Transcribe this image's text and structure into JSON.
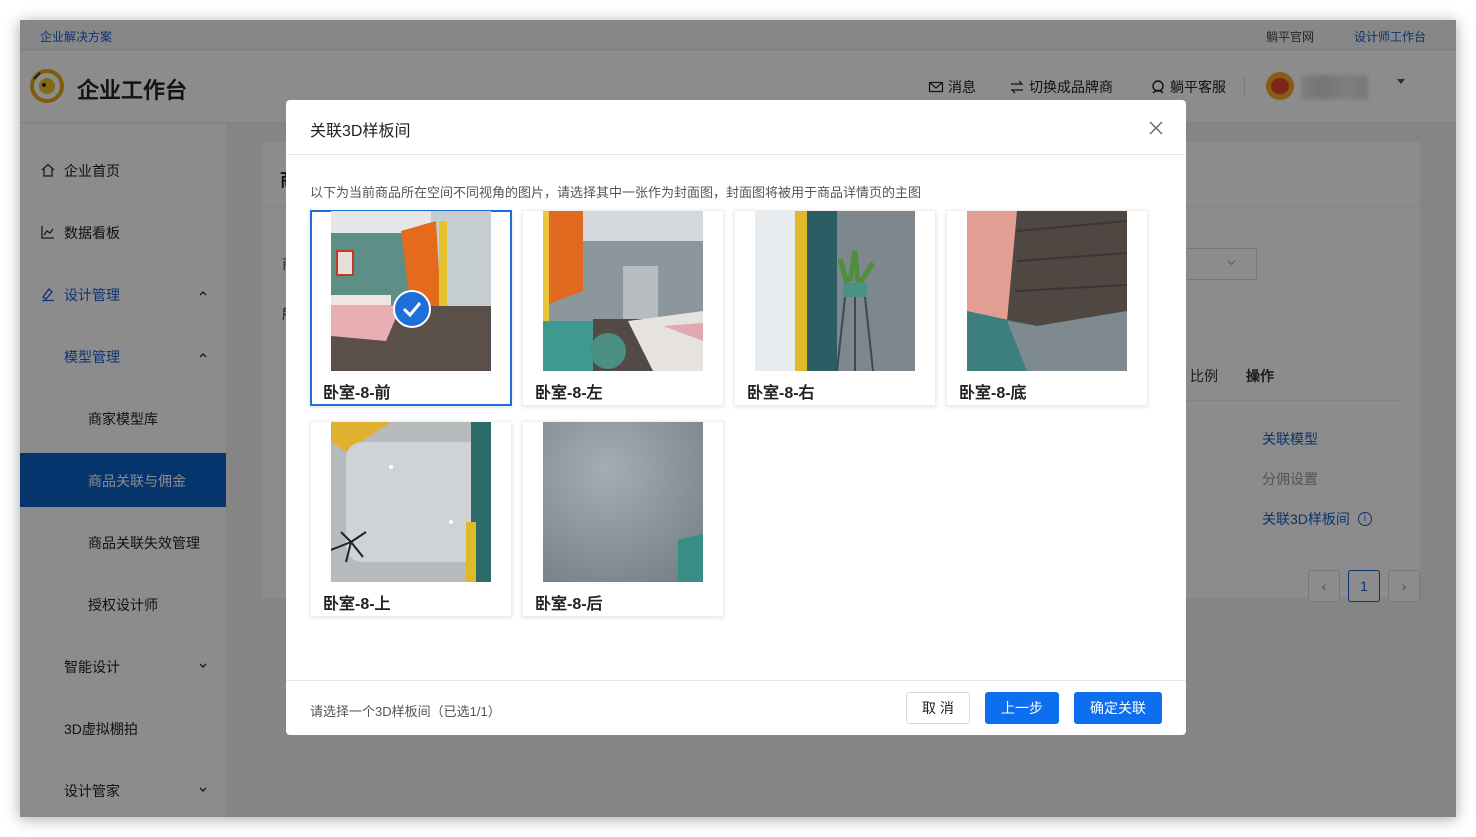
{
  "topbar": {
    "left_link": "企业解决方案",
    "right_link_1": "躺平官网",
    "right_link_2": "设计师工作台"
  },
  "header": {
    "app_title": "企业工作台",
    "nav": [
      {
        "icon": "mail-icon",
        "label": "消息"
      },
      {
        "icon": "switch-icon",
        "label": "切换成品牌商"
      },
      {
        "icon": "headset-icon",
        "label": "躺平客服"
      }
    ]
  },
  "sidebar": {
    "items": [
      {
        "label": "企业首页",
        "icon": "home-icon"
      },
      {
        "label": "数据看板",
        "icon": "chart-icon"
      },
      {
        "label": "设计管理",
        "icon": "design-icon",
        "expanded": true
      },
      {
        "label": "模型管理",
        "expanded": true
      },
      {
        "label": "商家模型库"
      },
      {
        "label": "商品关联与佣金",
        "selected": true
      },
      {
        "label": "商品关联失效管理"
      },
      {
        "label": "授权设计师"
      },
      {
        "label": "智能设计",
        "expanded": false
      },
      {
        "label": "3D虚拟棚拍"
      },
      {
        "label": "设计管家",
        "expanded": false
      }
    ]
  },
  "background_page": {
    "title_fragment": "商",
    "left_fragment_1": "商",
    "left_fragment_2": "所",
    "table_headers": [
      "比例",
      "操作"
    ],
    "actions": [
      "关联模型",
      "分佣设置",
      "关联3D样板间"
    ],
    "current_page": "1"
  },
  "modal": {
    "title": "关联3D样板间",
    "description": "以下为当前商品所在空间不同视角的图片，请选择其中一张作为封面图，封面图将被用于商品详情页的主图",
    "views": [
      {
        "label": "卧室-8-前",
        "selected": true
      },
      {
        "label": "卧室-8-左",
        "selected": false
      },
      {
        "label": "卧室-8-右",
        "selected": false
      },
      {
        "label": "卧室-8-底",
        "selected": false
      },
      {
        "label": "卧室-8-上",
        "selected": false
      },
      {
        "label": "卧室-8-后",
        "selected": false
      }
    ],
    "status": "请选择一个3D样板间（已选1/1）",
    "cancel_label": "取 消",
    "prev_label": "上一步",
    "confirm_label": "确定关联"
  },
  "colors": {
    "primary": "#0e6ef0",
    "sidebar_selected": "#0b5fc7",
    "link": "#1a5ccc"
  }
}
